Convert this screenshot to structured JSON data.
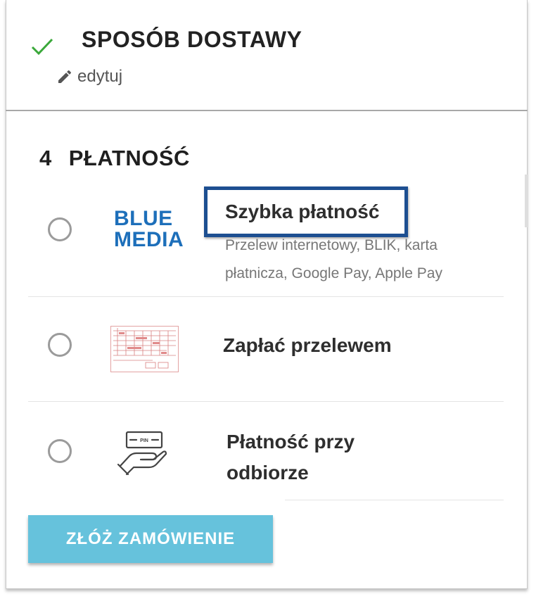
{
  "delivery": {
    "title": "SPOSÓB DOSTAWY",
    "edit_label": "edytuj",
    "status": "completed"
  },
  "payment": {
    "step_number": "4",
    "title": "PŁATNOŚĆ",
    "options": [
      {
        "logo_line1": "BLUE",
        "logo_line2": "MEDIA",
        "title": "Szybka płatność",
        "description_line1": "Przelew internetowy, BLIK, karta",
        "description_line2": "płatnicza, Google Pay, Apple Pay",
        "selected": false,
        "highlighted": true
      },
      {
        "icon": "bank-transfer-form-icon",
        "title": "Zapłać przelewem",
        "selected": false
      },
      {
        "icon": "cash-on-delivery-hand-card-icon",
        "title_line1": "Płatność przy",
        "title_line2": "odbiorze",
        "selected": false
      }
    ]
  },
  "submit": {
    "label": "ZŁÓŻ ZAMÓWIENIE"
  },
  "colors": {
    "check": "#3aa83a",
    "brand_logo": "#1d6fba",
    "highlight_border": "#1d4f91",
    "button_bg": "#66c2dc",
    "radio_border": "#9b9b9b"
  }
}
